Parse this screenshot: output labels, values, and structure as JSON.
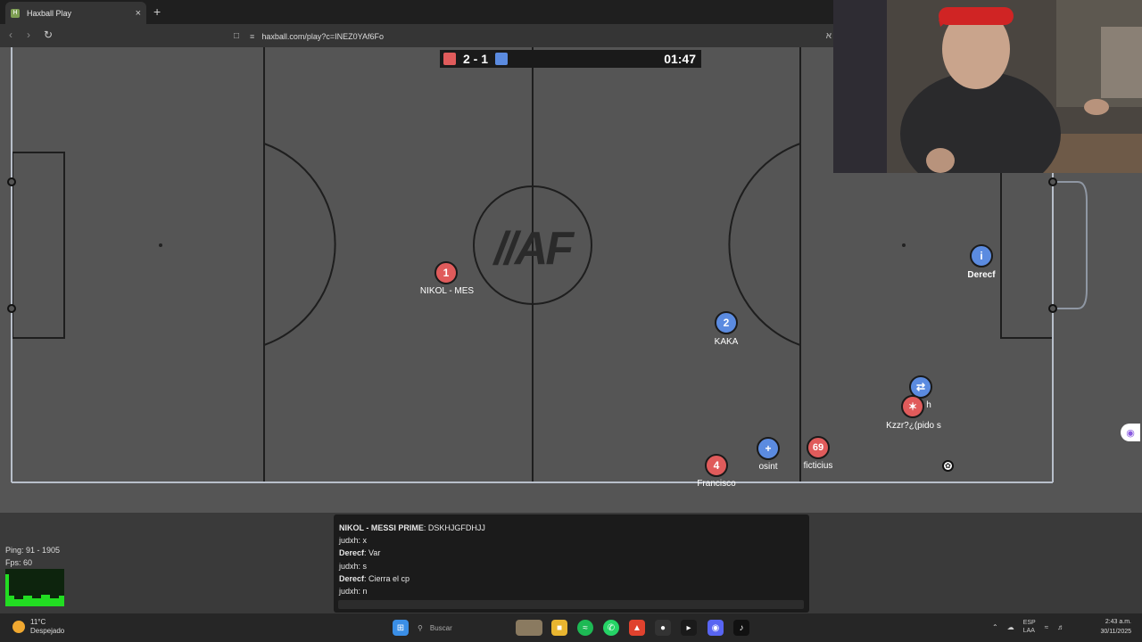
{
  "browser": {
    "tab_title": "Haxball Play",
    "tab_close": "×",
    "new_tab": "+",
    "url": "haxball.com/play?c=INEZ0YAf6Fo"
  },
  "game": {
    "score": "2 - 1",
    "time": "01:47",
    "center_logo": "//AF",
    "players": [
      {
        "number": "1",
        "name": "NIKOL - MES",
        "team": "red"
      },
      {
        "number": "2",
        "name": "KAKA",
        "team": "blue"
      },
      {
        "number": "i",
        "name": "Derecf",
        "team": "blue"
      },
      {
        "number": "⇄",
        "name": "h",
        "team": "blue"
      },
      {
        "number": "✶",
        "name": "Kzzr?¿(pido s",
        "team": "red"
      },
      {
        "number": "69",
        "name": "ficticius",
        "team": "red"
      },
      {
        "number": "+",
        "name": "osint",
        "team": "blue"
      },
      {
        "number": "4",
        "name": "Francisco",
        "team": "red"
      }
    ]
  },
  "chat": {
    "messages": [
      {
        "author": "NIKOL - MESSI PRIME",
        "text": "DSKHJGFDHJJ"
      },
      {
        "author": "judxh",
        "text": "x"
      },
      {
        "author": "Derecf",
        "text": "Var"
      },
      {
        "author": "judxh",
        "text": "s"
      },
      {
        "author": "Derecf",
        "text": "Cierra el cp"
      },
      {
        "author": "judxh",
        "text": "n"
      }
    ],
    "input_value": ""
  },
  "stats": {
    "ping": "Ping: 91 - 1905",
    "fps": "Fps: 60"
  },
  "taskbar": {
    "weather_temp": "11°C",
    "weather_desc": "Despejado",
    "search_placeholder": "Buscar",
    "lang": "ESP",
    "lang2": "LAA",
    "time": "2:43 a.m.",
    "date": "30/11/2025"
  }
}
